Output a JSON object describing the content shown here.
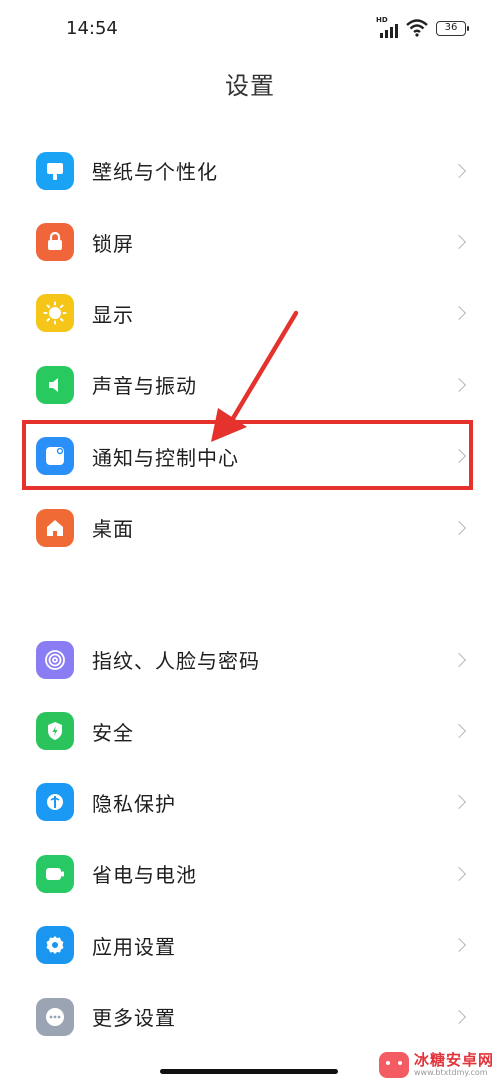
{
  "status_bar": {
    "time": "14:54",
    "network_badge": "HD",
    "battery": "36"
  },
  "header": {
    "title": "设置"
  },
  "group1": [
    {
      "label": "壁纸与个性化",
      "icon": "palette-icon",
      "color": "#1aa3f5"
    },
    {
      "label": "锁屏",
      "icon": "lock-icon",
      "color": "#f0663a"
    },
    {
      "label": "显示",
      "icon": "sun-icon",
      "color": "#f5c518"
    },
    {
      "label": "声音与振动",
      "icon": "speaker-icon",
      "color": "#28c95f"
    },
    {
      "label": "通知与控制中心",
      "icon": "notification-icon",
      "color": "#2a8ff6"
    },
    {
      "label": "桌面",
      "icon": "home-icon",
      "color": "#f06a35"
    }
  ],
  "group2": [
    {
      "label": "指纹、人脸与密码",
      "icon": "fingerprint-icon",
      "color": "#8a7cf2"
    },
    {
      "label": "安全",
      "icon": "shield-icon",
      "color": "#2bc45c"
    },
    {
      "label": "隐私保护",
      "icon": "privacy-icon",
      "color": "#1a9af5"
    },
    {
      "label": "省电与电池",
      "icon": "battery-icon",
      "color": "#28c965"
    },
    {
      "label": "应用设置",
      "icon": "gear-icon",
      "color": "#1a96f0"
    },
    {
      "label": "更多设置",
      "icon": "more-icon",
      "color": "#9aa4b2"
    }
  ],
  "annotation": {
    "highlight_color": "#e5322d",
    "highlighted_item": "通知与控制中心"
  },
  "watermark": {
    "name": "冰糖安卓网",
    "url": "www.btxtdmy.com"
  }
}
